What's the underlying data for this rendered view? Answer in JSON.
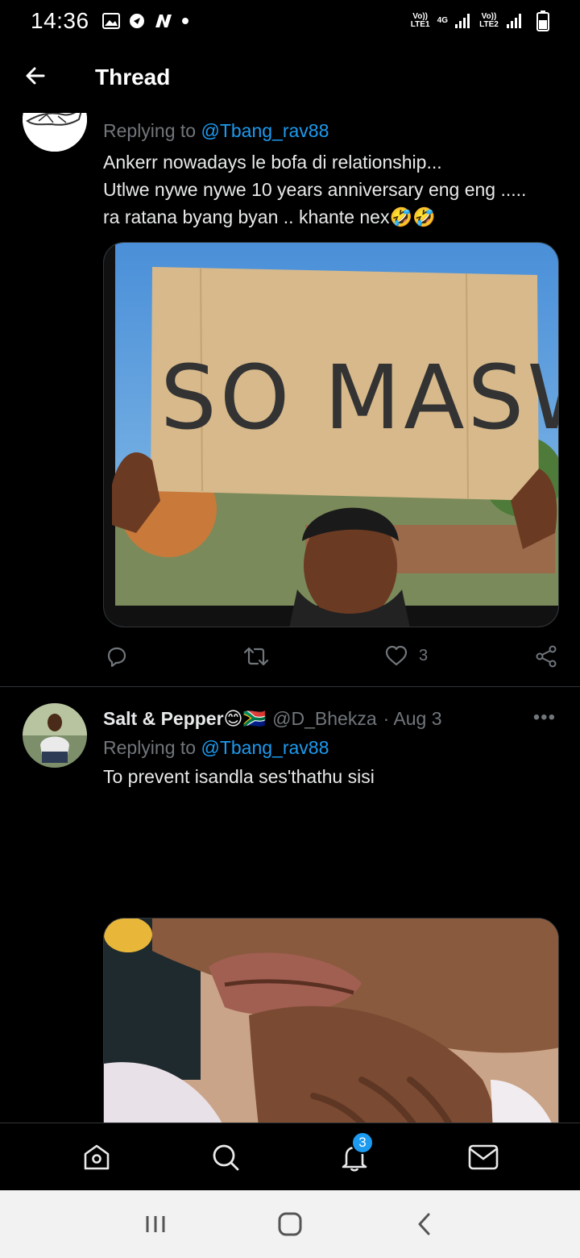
{
  "status_bar": {
    "time": "14:36",
    "sim1_label": "Vo)) LTE1",
    "net_label": "4G",
    "sim2_label": "Vo)) LTE2",
    "icons": [
      "gallery-icon",
      "location-icon",
      "n-app-icon",
      "dot-icon",
      "signal-icon",
      "battery-icon"
    ]
  },
  "header": {
    "title": "Thread"
  },
  "tweets": [
    {
      "replying_prefix": "Replying to ",
      "replying_handle": "@Tbang_rav88",
      "text_lines": [
        "Ankerr nowadays le bofa di relationship...",
        "Utlwe nywe nywe 10 years anniversary eng eng .....",
        "ra ratana byang byan .. khante nex🤣🤣"
      ],
      "image_caption": "SO MASWE",
      "like_count": "3"
    },
    {
      "display_name": "Salt & Pepper😊🇿🇦",
      "handle": "@D_Bhekza",
      "date": "· Aug 3",
      "more": "•••",
      "replying_prefix": "Replying to ",
      "replying_handle": "@Tbang_rav88",
      "text": "To prevent isandla ses'thathu sisi"
    }
  ],
  "bottom_nav": {
    "notifications_badge": "3",
    "items": [
      "home-icon",
      "search-icon",
      "notifications-icon",
      "messages-icon"
    ]
  },
  "colors": {
    "background": "#000000",
    "accent": "#1d9bf0",
    "muted": "#71767b",
    "text": "#e7e9ea",
    "divider": "#2f3336"
  }
}
